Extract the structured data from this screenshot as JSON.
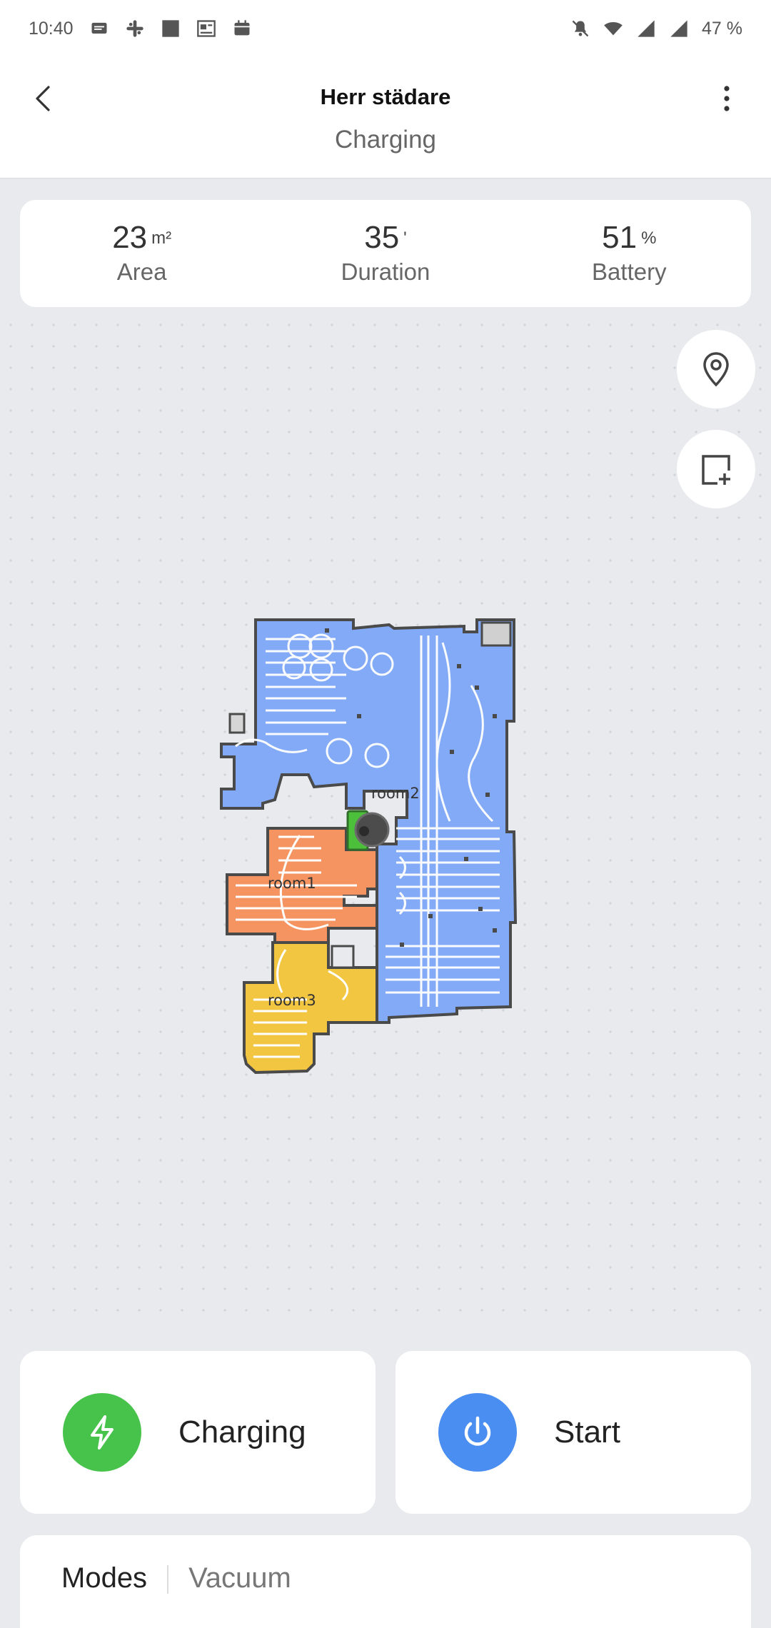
{
  "status_bar": {
    "time": "10:40",
    "battery": "47 %",
    "left_icons": [
      "message-icon",
      "slack-icon",
      "app-icon",
      "news-icon",
      "calendar-icon"
    ],
    "right_icons": [
      "mute-icon",
      "wifi-icon",
      "signal-icon",
      "signal-icon"
    ]
  },
  "header": {
    "title": "Herr städare",
    "subtitle": "Charging",
    "back_icon": "chevron-left-icon",
    "menu_icon": "more-vertical-icon"
  },
  "stats": {
    "area": {
      "value": "23",
      "unit": "m²",
      "label": "Area"
    },
    "duration": {
      "value": "35",
      "unit": "'",
      "label": "Duration"
    },
    "battery": {
      "value": "51",
      "unit": "%",
      "label": "Battery"
    }
  },
  "map": {
    "buttons": [
      "location-pin-icon",
      "add-zone-icon"
    ],
    "rooms": [
      {
        "name": "room1",
        "color": "#f59461"
      },
      {
        "name": "room2",
        "color": "#83aaf7"
      },
      {
        "name": "room3",
        "color": "#f2c641"
      }
    ],
    "robot_icon": "robot-vacuum-icon",
    "dock_icon": "charging-dock-icon"
  },
  "actions": {
    "charge": {
      "label": "Charging",
      "icon": "lightning-icon",
      "color": "#47c34b"
    },
    "start": {
      "label": "Start",
      "icon": "power-icon",
      "color": "#4b8ef1"
    }
  },
  "modes": {
    "label": "Modes",
    "value": "Vacuum"
  }
}
